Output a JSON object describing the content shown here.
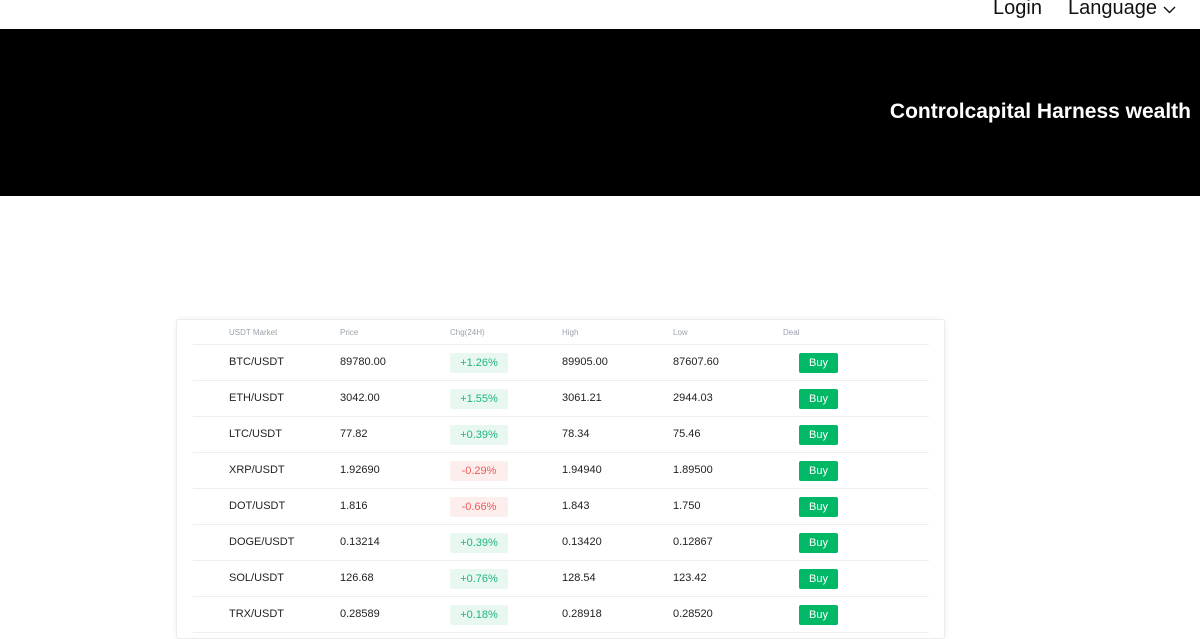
{
  "nav": {
    "login_label": "Login",
    "language_label": "Language"
  },
  "hero": {
    "title": "Controlcapital Harness wealth"
  },
  "market": {
    "columns": [
      "USDT Market",
      "Price",
      "Chg(24H)",
      "High",
      "Low",
      "Deal"
    ],
    "rows": [
      {
        "pair": "BTC/USDT",
        "price": "89780.00",
        "chg": "+1.26%",
        "direction": "up",
        "high": "89905.00",
        "low": "87607.60",
        "action": "Buy"
      },
      {
        "pair": "ETH/USDT",
        "price": "3042.00",
        "chg": "+1.55%",
        "direction": "up",
        "high": "3061.21",
        "low": "2944.03",
        "action": "Buy"
      },
      {
        "pair": "LTC/USDT",
        "price": "77.82",
        "chg": "+0.39%",
        "direction": "up",
        "high": "78.34",
        "low": "75.46",
        "action": "Buy"
      },
      {
        "pair": "XRP/USDT",
        "price": "1.92690",
        "chg": "-0.29%",
        "direction": "down",
        "high": "1.94940",
        "low": "1.89500",
        "action": "Buy"
      },
      {
        "pair": "DOT/USDT",
        "price": "1.816",
        "chg": "-0.66%",
        "direction": "down",
        "high": "1.843",
        "low": "1.750",
        "action": "Buy"
      },
      {
        "pair": "DOGE/USDT",
        "price": "0.13214",
        "chg": "+0.39%",
        "direction": "up",
        "high": "0.13420",
        "low": "0.12867",
        "action": "Buy"
      },
      {
        "pair": "SOL/USDT",
        "price": "126.68",
        "chg": "+0.76%",
        "direction": "up",
        "high": "128.54",
        "low": "123.42",
        "action": "Buy"
      },
      {
        "pair": "TRX/USDT",
        "price": "0.28589",
        "chg": "+0.18%",
        "direction": "up",
        "high": "0.28918",
        "low": "0.28520",
        "action": "Buy"
      }
    ]
  },
  "colors": {
    "up_text": "#1fb67a",
    "up_bg": "#e9f7f1",
    "down_text": "#ef5a5a",
    "down_bg": "#fdeeee",
    "buy_button": "#00b866",
    "hero_bg": "#000000"
  },
  "icons": {
    "language_dropdown": "chevron-down-icon"
  }
}
